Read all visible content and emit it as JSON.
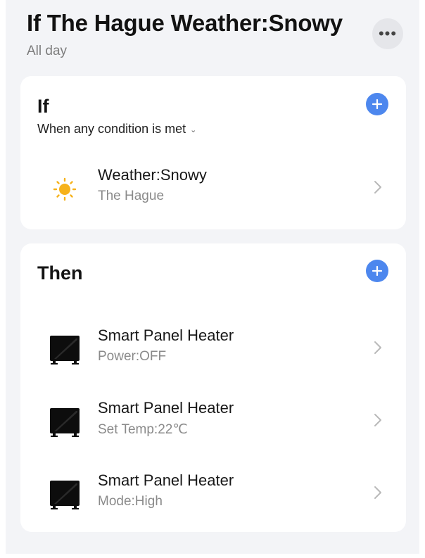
{
  "header": {
    "title": "If The Hague Weather:Snowy",
    "subtitle": "All day",
    "more_icon": "more-dots-icon"
  },
  "if_section": {
    "heading": "If",
    "condition_mode": "When any condition is met",
    "add_icon": "plus-circle-icon",
    "conditions": [
      {
        "icon": "sun-icon",
        "name": "Weather:Snowy",
        "detail": "The Hague"
      }
    ]
  },
  "then_section": {
    "heading": "Then",
    "add_icon": "plus-circle-icon",
    "actions": [
      {
        "icon": "panel-heater-icon",
        "name": "Smart Panel Heater",
        "detail": "Power:OFF"
      },
      {
        "icon": "panel-heater-icon",
        "name": "Smart Panel Heater",
        "detail": "Set Temp:22℃"
      },
      {
        "icon": "panel-heater-icon",
        "name": "Smart Panel Heater",
        "detail": "Mode:High"
      }
    ]
  },
  "colors": {
    "accent": "#4d87ee",
    "background": "#f3f4f7",
    "card": "#ffffff",
    "sun": "#f6b21b"
  }
}
